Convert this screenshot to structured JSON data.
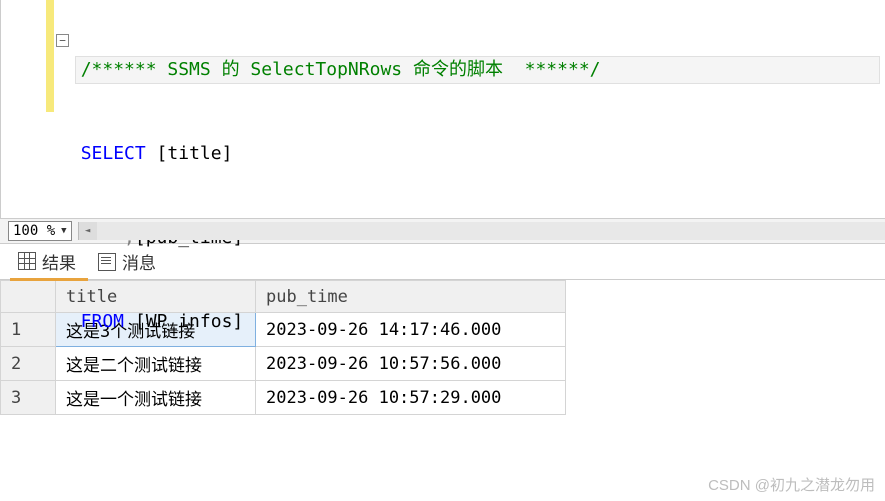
{
  "editor": {
    "line1_comment": "/****** SSMS 的 SelectTopNRows 命令的脚本  ******/",
    "line2_select": "SELECT",
    "line2_col": " [title]",
    "line3_comma": "      ,",
    "line3_col": "[pub_time]",
    "line4_from": "  FROM",
    "line4_table": " [WP_infos]"
  },
  "zoom": {
    "level": "100 %"
  },
  "tabs": {
    "results": "结果",
    "messages": "消息"
  },
  "grid": {
    "headers": {
      "title": "title",
      "pub_time": "pub_time"
    },
    "rows": [
      {
        "n": "1",
        "title": "这是3个测试链接",
        "pub_time": "2023-09-26 14:17:46.000"
      },
      {
        "n": "2",
        "title": "这是二个测试链接",
        "pub_time": "2023-09-26 10:57:56.000"
      },
      {
        "n": "3",
        "title": "这是一个测试链接",
        "pub_time": "2023-09-26 10:57:29.000"
      }
    ]
  },
  "watermark": "CSDN @初九之潜龙勿用"
}
